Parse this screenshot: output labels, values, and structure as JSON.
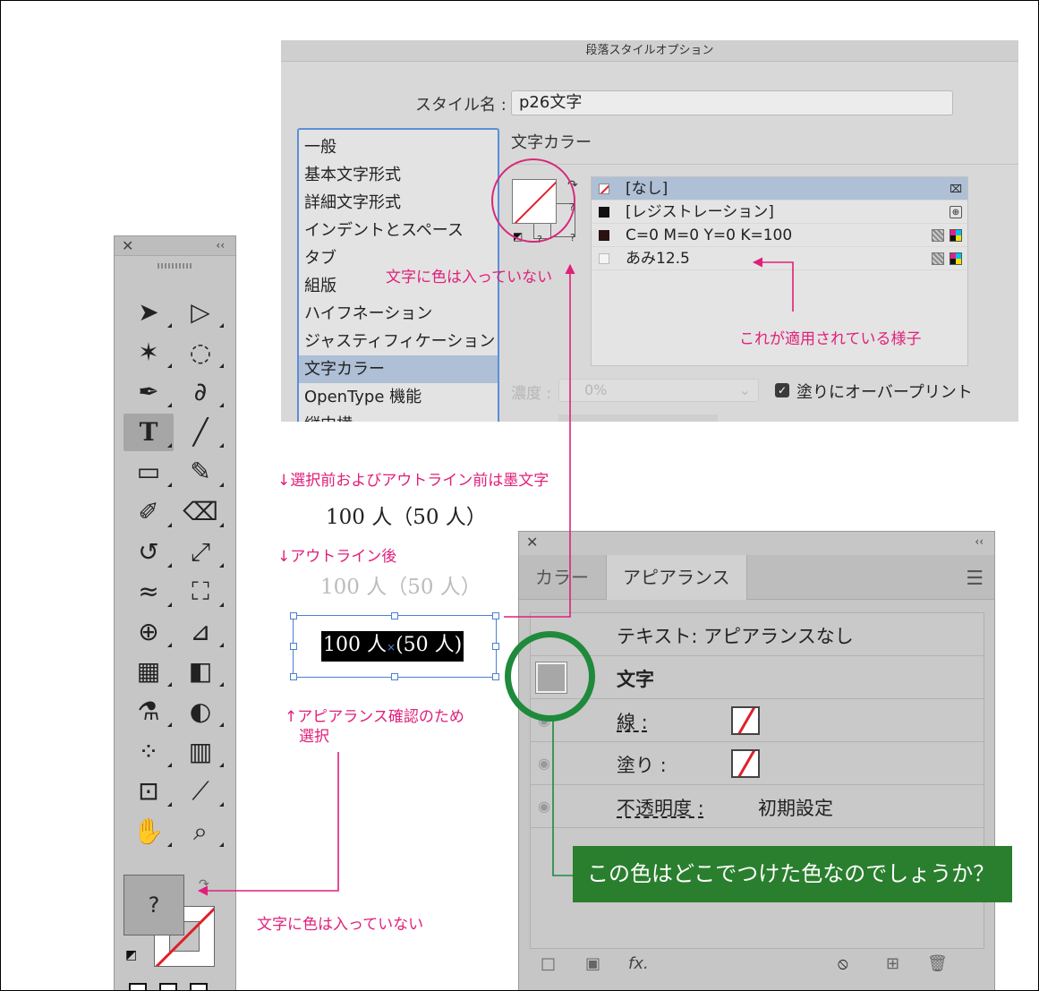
{
  "dialog": {
    "title": "段落スタイルオプション",
    "style_name_label": "スタイル名 :",
    "style_name_value": "p26文字",
    "section_title": "文字カラー",
    "categories": [
      {
        "label": "一般",
        "selected": false
      },
      {
        "label": "基本文字形式",
        "selected": false
      },
      {
        "label": "詳細文字形式",
        "selected": false
      },
      {
        "label": "インデントとスペース",
        "selected": false
      },
      {
        "label": "タブ",
        "selected": false
      },
      {
        "label": "組版",
        "selected": false
      },
      {
        "label": "ハイフネーション",
        "selected": false
      },
      {
        "label": "ジャスティフィケーション",
        "selected": false
      },
      {
        "label": "文字カラー",
        "selected": true
      },
      {
        "label": "OpenType 機能",
        "selected": false
      },
      {
        "label": "縦中横",
        "selected": false
      }
    ],
    "swatches": [
      {
        "label": "[なし]",
        "chip": "none",
        "selected": true,
        "icons": [
          "no-edit-icon"
        ]
      },
      {
        "label": "[レジストレーション]",
        "chip": "black",
        "selected": false,
        "icons": [
          "registration-icon"
        ]
      },
      {
        "label": "C=0 M=0 Y=0 K=100",
        "chip": "dark",
        "selected": false,
        "icons": [
          "process-grid-icon",
          "cmyk-icon"
        ]
      },
      {
        "label": "あみ12.5",
        "chip": "ami",
        "selected": false,
        "icons": [
          "process-grid-icon",
          "cmyk-icon"
        ]
      }
    ],
    "tint_label": "濃度 :",
    "tint_value": "0%",
    "overprint_label": "塗りにオーバープリント",
    "overprint_checked": true,
    "swatch_q1": "?",
    "swatch_q2": "?",
    "swatch_q3": "?"
  },
  "annotations": {
    "no_color_top": "文字に色は入っていない",
    "applied": "これが適用されている様子",
    "before": "↓選択前およびアウトライン前は墨文字",
    "after": "↓アウトライン後",
    "select_line1": "↑アピアランス確認のため",
    "select_line2": "選択",
    "no_color_bottom": "文字に色は入っていない",
    "question": "この色はどこでつけた色なのでしょうか？"
  },
  "samples": {
    "black": "100 人（50 人）",
    "faded": "100 人（50 人）",
    "selected_part1": "100 人",
    "selected_part2": "(50 人)"
  },
  "tools_panel": {
    "close": "✕",
    "collapse": "‹‹",
    "fill_label": "?",
    "tools": [
      {
        "name": "selection-tool",
        "glyph": "➤"
      },
      {
        "name": "direct-selection-tool",
        "glyph": "▷"
      },
      {
        "name": "magic-wand-tool",
        "glyph": "✶"
      },
      {
        "name": "lasso-tool",
        "glyph": "◌"
      },
      {
        "name": "pen-tool",
        "glyph": "✒"
      },
      {
        "name": "curvature-tool",
        "glyph": "∂"
      },
      {
        "name": "type-tool",
        "glyph": "T"
      },
      {
        "name": "line-tool",
        "glyph": "╱"
      },
      {
        "name": "rectangle-tool",
        "glyph": "▭"
      },
      {
        "name": "paintbrush-tool",
        "glyph": "✎"
      },
      {
        "name": "shaper-tool",
        "glyph": "✐"
      },
      {
        "name": "eraser-tool",
        "glyph": "⌫"
      },
      {
        "name": "rotate-tool",
        "glyph": "↺"
      },
      {
        "name": "scale-tool",
        "glyph": "⤢"
      },
      {
        "name": "warp-tool",
        "glyph": "≈"
      },
      {
        "name": "free-transform-tool",
        "glyph": "⛶"
      },
      {
        "name": "shape-builder-tool",
        "glyph": "⊕"
      },
      {
        "name": "perspective-grid-tool",
        "glyph": "⊿"
      },
      {
        "name": "mesh-tool",
        "glyph": "▦"
      },
      {
        "name": "gradient-tool",
        "glyph": "◧"
      },
      {
        "name": "eyedropper-tool",
        "glyph": "⚗"
      },
      {
        "name": "blend-tool",
        "glyph": "◐"
      },
      {
        "name": "symbol-sprayer-tool",
        "glyph": "⁘"
      },
      {
        "name": "column-graph-tool",
        "glyph": "▥"
      },
      {
        "name": "artboard-tool",
        "glyph": "⊡"
      },
      {
        "name": "slice-tool",
        "glyph": "⟋"
      },
      {
        "name": "hand-tool",
        "glyph": "✋"
      },
      {
        "name": "zoom-tool",
        "glyph": "⌕"
      }
    ]
  },
  "appearance_panel": {
    "close": "✕",
    "collapse": "‹‹",
    "tabs": [
      {
        "label": "カラー",
        "active": false
      },
      {
        "label": "アピアランス",
        "active": true
      }
    ],
    "menu": "☰",
    "header_row": "テキスト: アピアランスなし",
    "text_row": "文字",
    "stroke_label": "線 :",
    "fill_label": "塗り :",
    "opacity_label": "不透明度 :",
    "opacity_value": "初期設定",
    "eye": "◉",
    "footer": {
      "new_stroke": "□",
      "new_fill": "▣",
      "fx": "fx.",
      "clear": "⦸",
      "duplicate": "⊞",
      "delete": "🗑"
    }
  },
  "colors": {
    "annotation": "#e0207a",
    "callout": "#2a7f2e",
    "highlight_circle": "#1f8a3c",
    "selection": "#4a7fd6",
    "none_slash": "#e0202c"
  }
}
